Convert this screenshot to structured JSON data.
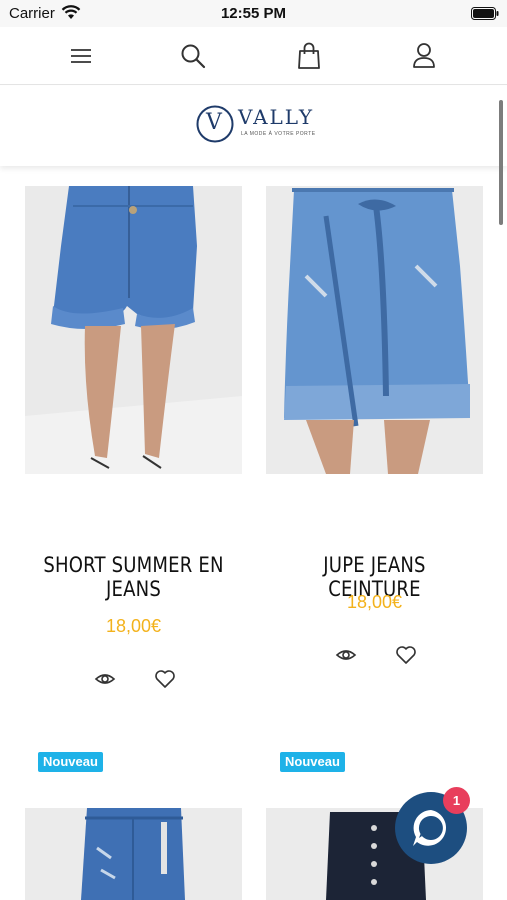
{
  "status_bar": {
    "carrier": "Carrier",
    "time": "12:55 PM",
    "wifi_icon": "wifi-icon",
    "battery_icon": "battery-full-icon"
  },
  "nav": {
    "icons": [
      "menu-icon",
      "search-icon",
      "shopping-bag-icon",
      "user-account-icon"
    ]
  },
  "brand": {
    "logo_letter": "V",
    "name": "VALLY",
    "tagline": "LA MODE À VOTRE PORTE",
    "color": "#1f3b6a"
  },
  "products": [
    {
      "title": "SHORT SUMMER EN JEANS",
      "price": "18,00€",
      "image": "denim-shorts-photo",
      "actions": [
        "eye-icon",
        "heart-icon"
      ]
    },
    {
      "title": "JUPE JEANS CEINTURE",
      "price": "18,00€",
      "image": "denim-skirt-photo",
      "actions": [
        "eye-icon",
        "heart-icon"
      ]
    },
    {
      "badge": "Nouveau",
      "image": "denim-jeans-photo"
    },
    {
      "badge": "Nouveau",
      "image": "dark-jeans-photo"
    }
  ],
  "chat": {
    "icon": "chat-bubble-icon",
    "unread": "1"
  },
  "colors": {
    "price": "#f3b21c",
    "badge": "#1eb2e8",
    "chat_button": "#1d4e80",
    "chat_badge": "#e83e5c"
  }
}
